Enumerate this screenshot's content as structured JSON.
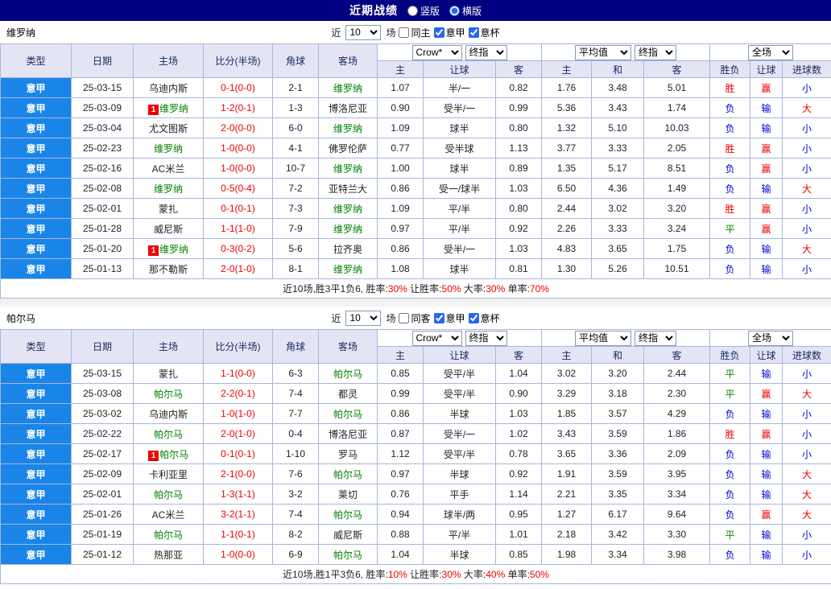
{
  "topbar": {
    "title": "近期战绩",
    "radios": [
      {
        "label": "竖版",
        "checked": false
      },
      {
        "label": "横版",
        "checked": true
      }
    ]
  },
  "labels": {
    "near": "近",
    "games": "场"
  },
  "columns": {
    "type": "类型",
    "date": "日期",
    "home": "主场",
    "score": "比分(半场)",
    "corner": "角球",
    "away": "客场",
    "odds": [
      "主",
      "让球",
      "客"
    ],
    "avg": [
      "主",
      "和",
      "客"
    ],
    "result": [
      "胜负",
      "让球",
      "进球数"
    ]
  },
  "selects": {
    "odds_source": "Crow*",
    "final": "终指",
    "avg_source": "平均值",
    "scope": "全场"
  },
  "colors": {
    "topbar_bg": "#000080",
    "type_cell_bg": "#1a85e8",
    "header_bg": "#e3e5f5",
    "grid_border": "#a9b6dc",
    "win_red": "#ee0000",
    "loss_blue": "#0000d8",
    "draw_green": "#008800",
    "team_green": "#008000",
    "score_red": "#ee0000"
  },
  "sections": [
    {
      "team": "维罗纳",
      "filter": {
        "count": "10",
        "checkboxes": [
          {
            "label": "同主",
            "checked": false
          },
          {
            "label": "意甲",
            "checked": true
          },
          {
            "label": "意杯",
            "checked": true
          }
        ]
      },
      "rows": [
        {
          "lg": "意甲",
          "date": "25-03-15",
          "home": {
            "n": "乌迪内斯"
          },
          "score": "0-1(0-0)",
          "corner": "2-1",
          "away": {
            "n": "维罗纳",
            "g": true
          },
          "o": [
            "1.07",
            "半/一",
            "0.82"
          ],
          "a": [
            "1.76",
            "3.48",
            "5.01"
          ],
          "res": [
            {
              "t": "胜",
              "c": "r"
            },
            {
              "t": "赢",
              "c": "r"
            },
            {
              "t": "小",
              "c": "b"
            }
          ]
        },
        {
          "lg": "意甲",
          "date": "25-03-09",
          "home": {
            "n": "维罗纳",
            "g": true,
            "b": "1"
          },
          "score": "1-2(0-1)",
          "corner": "1-3",
          "away": {
            "n": "博洛尼亚"
          },
          "o": [
            "0.90",
            "受半/一",
            "0.99"
          ],
          "a": [
            "5.36",
            "3.43",
            "1.74"
          ],
          "res": [
            {
              "t": "负",
              "c": "b"
            },
            {
              "t": "输",
              "c": "b"
            },
            {
              "t": "大",
              "c": "r"
            }
          ]
        },
        {
          "lg": "意甲",
          "date": "25-03-04",
          "home": {
            "n": "尤文图斯"
          },
          "score": "2-0(0-0)",
          "corner": "6-0",
          "away": {
            "n": "维罗纳",
            "g": true
          },
          "o": [
            "1.09",
            "球半",
            "0.80"
          ],
          "a": [
            "1.32",
            "5.10",
            "10.03"
          ],
          "res": [
            {
              "t": "负",
              "c": "b"
            },
            {
              "t": "输",
              "c": "b"
            },
            {
              "t": "小",
              "c": "b"
            }
          ]
        },
        {
          "lg": "意甲",
          "date": "25-02-23",
          "home": {
            "n": "维罗纳",
            "g": true
          },
          "score": "1-0(0-0)",
          "corner": "4-1",
          "away": {
            "n": "佛罗伦萨"
          },
          "o": [
            "0.77",
            "受半球",
            "1.13"
          ],
          "a": [
            "3.77",
            "3.33",
            "2.05"
          ],
          "res": [
            {
              "t": "胜",
              "c": "r"
            },
            {
              "t": "赢",
              "c": "r"
            },
            {
              "t": "小",
              "c": "b"
            }
          ]
        },
        {
          "lg": "意甲",
          "date": "25-02-16",
          "home": {
            "n": "AC米兰"
          },
          "score": "1-0(0-0)",
          "corner": "10-7",
          "away": {
            "n": "维罗纳",
            "g": true
          },
          "o": [
            "1.00",
            "球半",
            "0.89"
          ],
          "a": [
            "1.35",
            "5.17",
            "8.51"
          ],
          "res": [
            {
              "t": "负",
              "c": "b"
            },
            {
              "t": "赢",
              "c": "r"
            },
            {
              "t": "小",
              "c": "b"
            }
          ]
        },
        {
          "lg": "意甲",
          "date": "25-02-08",
          "home": {
            "n": "维罗纳",
            "g": true
          },
          "score": "0-5(0-4)",
          "corner": "7-2",
          "away": {
            "n": "亚特兰大"
          },
          "o": [
            "0.86",
            "受一/球半",
            "1.03"
          ],
          "a": [
            "6.50",
            "4.36",
            "1.49"
          ],
          "res": [
            {
              "t": "负",
              "c": "b"
            },
            {
              "t": "输",
              "c": "b"
            },
            {
              "t": "大",
              "c": "r"
            }
          ]
        },
        {
          "lg": "意甲",
          "date": "25-02-01",
          "home": {
            "n": "蒙扎"
          },
          "score": "0-1(0-1)",
          "corner": "7-3",
          "away": {
            "n": "维罗纳",
            "g": true
          },
          "o": [
            "1.09",
            "平/半",
            "0.80"
          ],
          "a": [
            "2.44",
            "3.02",
            "3.20"
          ],
          "res": [
            {
              "t": "胜",
              "c": "r"
            },
            {
              "t": "赢",
              "c": "r"
            },
            {
              "t": "小",
              "c": "b"
            }
          ]
        },
        {
          "lg": "意甲",
          "date": "25-01-28",
          "home": {
            "n": "威尼斯"
          },
          "score": "1-1(1-0)",
          "corner": "7-9",
          "away": {
            "n": "维罗纳",
            "g": true
          },
          "o": [
            "0.97",
            "平/半",
            "0.92"
          ],
          "a": [
            "2.26",
            "3.33",
            "3.24"
          ],
          "res": [
            {
              "t": "平",
              "c": "g"
            },
            {
              "t": "赢",
              "c": "r"
            },
            {
              "t": "小",
              "c": "b"
            }
          ]
        },
        {
          "lg": "意甲",
          "date": "25-01-20",
          "home": {
            "n": "维罗纳",
            "g": true,
            "b": "1"
          },
          "score": "0-3(0-2)",
          "corner": "5-6",
          "away": {
            "n": "拉齐奥"
          },
          "o": [
            "0.86",
            "受半/一",
            "1.03"
          ],
          "a": [
            "4.83",
            "3.65",
            "1.75"
          ],
          "res": [
            {
              "t": "负",
              "c": "b"
            },
            {
              "t": "输",
              "c": "b"
            },
            {
              "t": "大",
              "c": "r"
            }
          ]
        },
        {
          "lg": "意甲",
          "date": "25-01-13",
          "home": {
            "n": "那不勒斯"
          },
          "score": "2-0(1-0)",
          "corner": "8-1",
          "away": {
            "n": "维罗纳",
            "g": true
          },
          "o": [
            "1.08",
            "球半",
            "0.81"
          ],
          "a": [
            "1.30",
            "5.26",
            "10.51"
          ],
          "res": [
            {
              "t": "负",
              "c": "b"
            },
            {
              "t": "输",
              "c": "b"
            },
            {
              "t": "小",
              "c": "b"
            }
          ]
        }
      ],
      "summary": [
        {
          "t": "近10场,胜3平1负6, 胜率:",
          "c": "k"
        },
        {
          "t": "30%",
          "c": "r"
        },
        {
          "t": " 让胜率:",
          "c": "k"
        },
        {
          "t": "50%",
          "c": "r"
        },
        {
          "t": " 大率:",
          "c": "k"
        },
        {
          "t": "30%",
          "c": "r"
        },
        {
          "t": " 单率:",
          "c": "k"
        },
        {
          "t": "70%",
          "c": "r"
        }
      ]
    },
    {
      "team": "帕尔马",
      "filter": {
        "count": "10",
        "checkboxes": [
          {
            "label": "同客",
            "checked": false
          },
          {
            "label": "意甲",
            "checked": true
          },
          {
            "label": "意杯",
            "checked": true
          }
        ]
      },
      "rows": [
        {
          "lg": "意甲",
          "date": "25-03-15",
          "home": {
            "n": "蒙扎"
          },
          "score": "1-1(0-0)",
          "corner": "6-3",
          "away": {
            "n": "帕尔马",
            "g": true
          },
          "o": [
            "0.85",
            "受平/半",
            "1.04"
          ],
          "a": [
            "3.02",
            "3.20",
            "2.44"
          ],
          "res": [
            {
              "t": "平",
              "c": "g"
            },
            {
              "t": "输",
              "c": "b"
            },
            {
              "t": "小",
              "c": "b"
            }
          ]
        },
        {
          "lg": "意甲",
          "date": "25-03-08",
          "home": {
            "n": "帕尔马",
            "g": true
          },
          "score": "2-2(0-1)",
          "corner": "7-4",
          "away": {
            "n": "都灵"
          },
          "o": [
            "0.99",
            "受平/半",
            "0.90"
          ],
          "a": [
            "3.29",
            "3.18",
            "2.30"
          ],
          "res": [
            {
              "t": "平",
              "c": "g"
            },
            {
              "t": "赢",
              "c": "r"
            },
            {
              "t": "大",
              "c": "r"
            }
          ]
        },
        {
          "lg": "意甲",
          "date": "25-03-02",
          "home": {
            "n": "乌迪内斯"
          },
          "score": "1-0(1-0)",
          "corner": "7-7",
          "away": {
            "n": "帕尔马",
            "g": true
          },
          "o": [
            "0.86",
            "半球",
            "1.03"
          ],
          "a": [
            "1.85",
            "3.57",
            "4.29"
          ],
          "res": [
            {
              "t": "负",
              "c": "b"
            },
            {
              "t": "输",
              "c": "b"
            },
            {
              "t": "小",
              "c": "b"
            }
          ]
        },
        {
          "lg": "意甲",
          "date": "25-02-22",
          "home": {
            "n": "帕尔马",
            "g": true
          },
          "score": "2-0(1-0)",
          "corner": "0-4",
          "away": {
            "n": "博洛尼亚"
          },
          "o": [
            "0.87",
            "受半/一",
            "1.02"
          ],
          "a": [
            "3.43",
            "3.59",
            "1.86"
          ],
          "res": [
            {
              "t": "胜",
              "c": "r"
            },
            {
              "t": "赢",
              "c": "r"
            },
            {
              "t": "小",
              "c": "b"
            }
          ]
        },
        {
          "lg": "意甲",
          "date": "25-02-17",
          "home": {
            "n": "帕尔马",
            "g": true,
            "b": "1"
          },
          "score": "0-1(0-1)",
          "corner": "1-10",
          "away": {
            "n": "罗马"
          },
          "o": [
            "1.12",
            "受平/半",
            "0.78"
          ],
          "a": [
            "3.65",
            "3.36",
            "2.09"
          ],
          "res": [
            {
              "t": "负",
              "c": "b"
            },
            {
              "t": "输",
              "c": "b"
            },
            {
              "t": "小",
              "c": "b"
            }
          ]
        },
        {
          "lg": "意甲",
          "date": "25-02-09",
          "home": {
            "n": "卡利亚里"
          },
          "score": "2-1(0-0)",
          "corner": "7-6",
          "away": {
            "n": "帕尔马",
            "g": true
          },
          "o": [
            "0.97",
            "半球",
            "0.92"
          ],
          "a": [
            "1.91",
            "3.59",
            "3.95"
          ],
          "res": [
            {
              "t": "负",
              "c": "b"
            },
            {
              "t": "输",
              "c": "b"
            },
            {
              "t": "大",
              "c": "r"
            }
          ]
        },
        {
          "lg": "意甲",
          "date": "25-02-01",
          "home": {
            "n": "帕尔马",
            "g": true
          },
          "score": "1-3(1-1)",
          "corner": "3-2",
          "away": {
            "n": "莱切"
          },
          "o": [
            "0.76",
            "平手",
            "1.14"
          ],
          "a": [
            "2.21",
            "3.35",
            "3.34"
          ],
          "res": [
            {
              "t": "负",
              "c": "b"
            },
            {
              "t": "输",
              "c": "b"
            },
            {
              "t": "大",
              "c": "r"
            }
          ]
        },
        {
          "lg": "意甲",
          "date": "25-01-26",
          "home": {
            "n": "AC米兰"
          },
          "score": "3-2(1-1)",
          "corner": "7-4",
          "away": {
            "n": "帕尔马",
            "g": true
          },
          "o": [
            "0.94",
            "球半/两",
            "0.95"
          ],
          "a": [
            "1.27",
            "6.17",
            "9.64"
          ],
          "res": [
            {
              "t": "负",
              "c": "b"
            },
            {
              "t": "赢",
              "c": "r"
            },
            {
              "t": "大",
              "c": "r"
            }
          ]
        },
        {
          "lg": "意甲",
          "date": "25-01-19",
          "home": {
            "n": "帕尔马",
            "g": true
          },
          "score": "1-1(0-1)",
          "corner": "8-2",
          "away": {
            "n": "威尼斯"
          },
          "o": [
            "0.88",
            "平/半",
            "1.01"
          ],
          "a": [
            "2.18",
            "3.42",
            "3.30"
          ],
          "res": [
            {
              "t": "平",
              "c": "g"
            },
            {
              "t": "输",
              "c": "b"
            },
            {
              "t": "小",
              "c": "b"
            }
          ]
        },
        {
          "lg": "意甲",
          "date": "25-01-12",
          "home": {
            "n": "热那亚"
          },
          "score": "1-0(0-0)",
          "corner": "6-9",
          "away": {
            "n": "帕尔马",
            "g": true
          },
          "o": [
            "1.04",
            "半球",
            "0.85"
          ],
          "a": [
            "1.98",
            "3.34",
            "3.98"
          ],
          "res": [
            {
              "t": "负",
              "c": "b"
            },
            {
              "t": "输",
              "c": "b"
            },
            {
              "t": "小",
              "c": "b"
            }
          ]
        }
      ],
      "summary": [
        {
          "t": "近10场,胜1平3负6, 胜率:",
          "c": "k"
        },
        {
          "t": "10%",
          "c": "r"
        },
        {
          "t": " 让胜率:",
          "c": "k"
        },
        {
          "t": "30%",
          "c": "r"
        },
        {
          "t": " 大率:",
          "c": "k"
        },
        {
          "t": "40%",
          "c": "r"
        },
        {
          "t": " 单率:",
          "c": "k"
        },
        {
          "t": "50%",
          "c": "r"
        }
      ]
    }
  ]
}
